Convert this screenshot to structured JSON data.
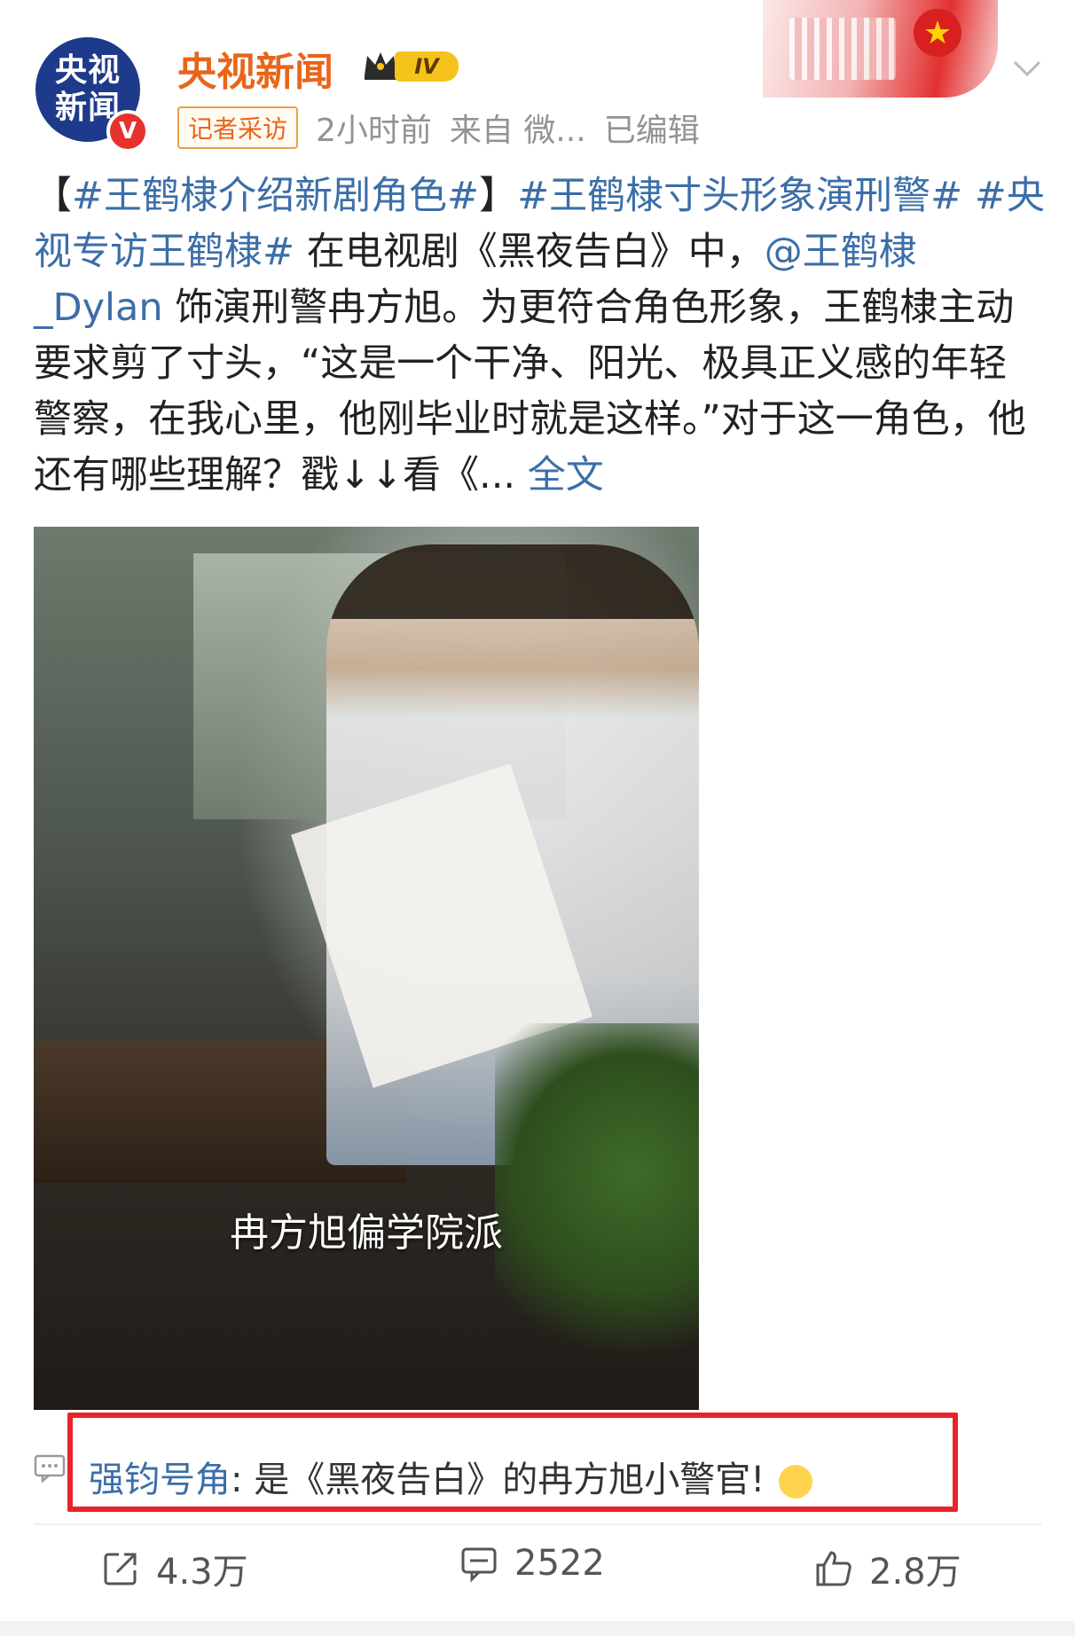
{
  "header": {
    "avatar_line1": "央视",
    "avatar_line2": "新闻",
    "verified_badge": "V",
    "username": "央视新闻",
    "level": "IV",
    "tag": "记者采访",
    "time": "2小时前",
    "source": "来自 微...",
    "edited": "已编辑"
  },
  "post": {
    "hashtag1": "#王鹤棣介绍新剧角色#",
    "bracket_open": "【",
    "bracket_close": "】",
    "hashtag2": "#王鹤棣寸头形象演刑警#",
    "hashtag3": "#央视专访王鹤棣#",
    "text1": " 在电视剧《黑夜告白》中，",
    "mention": "@王鹤棣_Dylan",
    "text2": " 饰演刑警冉方旭。为更符合角色形象，王鹤棣主动要求剪了寸头，“这是一个干净、阳光、极具正义感的年轻警察，在我心里，他刚毕业时就是这样。”对于这一角色，他还有哪些理解？戳↓↓看《...",
    "full_text_link": " 全文"
  },
  "media": {
    "subtitle": "冉方旭偏学院派"
  },
  "comment": {
    "author": "强钧号角",
    "colon": ": ",
    "text": "是《黑夜告白》的冉方旭小警官!"
  },
  "actions": {
    "share_count": "4.3万",
    "comment_count": "2522",
    "like_count": "2.8万"
  },
  "colors": {
    "username": "#e8651a",
    "link": "#3c6ea8",
    "highlight": "#e8232b"
  }
}
